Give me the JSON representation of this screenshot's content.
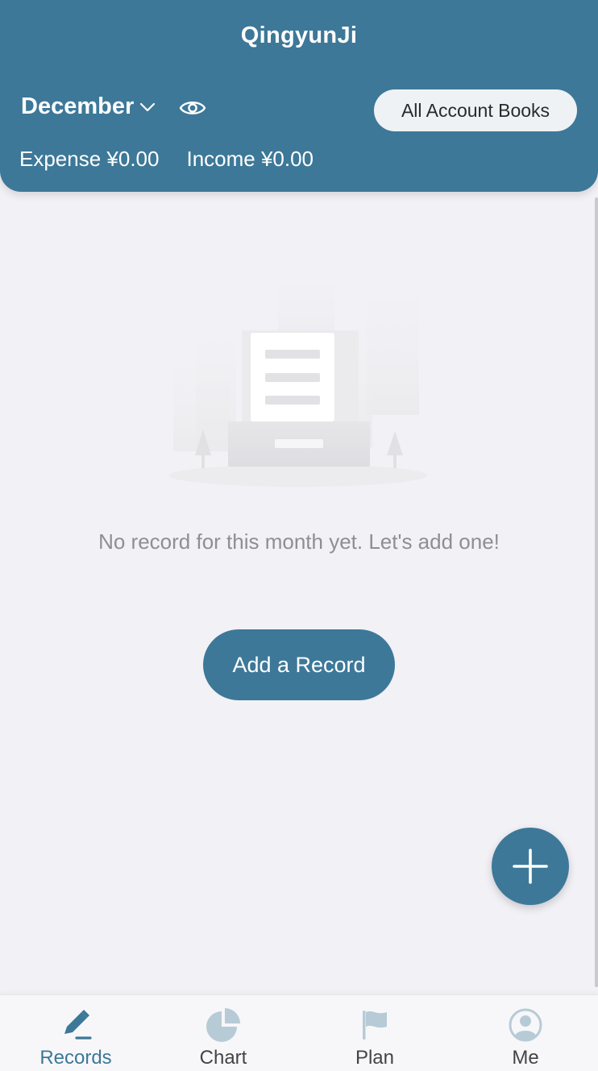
{
  "header": {
    "app_title": "QingyunJi",
    "month": "December",
    "visibility_icon": "eye-icon",
    "account_books_label": "All Account Books",
    "expense_text": "Expense ¥0.00",
    "income_text": "Income ¥0.00"
  },
  "main": {
    "empty_illustration": "empty-records-illustration",
    "empty_message": "No record for this month yet. Let's add one!",
    "add_record_label": "Add a Record",
    "fab_icon": "plus-icon"
  },
  "tabbar": {
    "items": [
      {
        "label": "Records",
        "icon": "pencil-icon",
        "active": true
      },
      {
        "label": "Chart",
        "icon": "pie-chart-icon",
        "active": false
      },
      {
        "label": "Plan",
        "icon": "flag-icon",
        "active": false
      },
      {
        "label": "Me",
        "icon": "user-icon",
        "active": false
      }
    ]
  },
  "colors": {
    "primary": "#3d7898",
    "background": "#f2f1f6",
    "muted_text": "#8e8e93",
    "inactive_icon": "#b7cbd6"
  }
}
